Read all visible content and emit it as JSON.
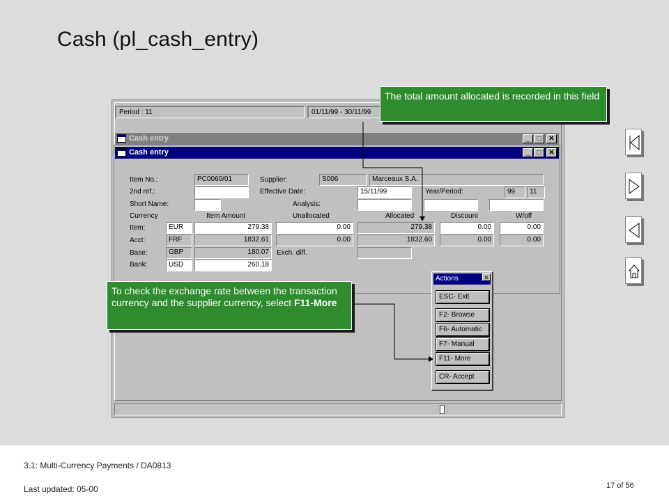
{
  "slide": {
    "title": "Cash (pl_cash_entry)",
    "footer_left": "3.1: Multi-Currency  Payments / DA0813",
    "footer_updated": "Last updated:  05-00",
    "page_label": "17 of 56"
  },
  "app": {
    "period_field": "Period : 11",
    "date_range_field": "01/11/99 - 30/11/99"
  },
  "windows": {
    "back_title": "Cash entry",
    "front_title": "Cash entry",
    "btn_min": "_",
    "btn_max": "□",
    "btn_close": "✕"
  },
  "form": {
    "labels": {
      "item_no": "Item No.:",
      "second_ref": "2nd ref.:",
      "short_name": "Short Name:",
      "currency": "Currency",
      "item": "Item:",
      "acct": "Acct:",
      "base": "Base:",
      "bank": "Bank:",
      "supplier": "Supplier:",
      "effective_date": "Effective Date:",
      "analysis": "Analysis:",
      "year_period": "Year/Period:",
      "exch_diff": "Exch. diff."
    },
    "columns": {
      "item_amount": "Item Amount",
      "unallocated": "Unallocated",
      "allocated": "Allocated",
      "discount": "Discount",
      "w_off": "W/off"
    },
    "values": {
      "item_no": "PC0060/01",
      "second_ref": "",
      "short_name": "",
      "supplier_code": "S006",
      "supplier_name": "Marceaux S.A.",
      "effective_date": "15/11/99",
      "year": "99",
      "period": "11",
      "analysis_1": "",
      "analysis_2": "",
      "analysis_3": ""
    },
    "rows": [
      {
        "currency": "EUR",
        "item_amount": "279.38",
        "unallocated": "0.00",
        "allocated": "279.38",
        "discount": "0.00",
        "w_off": "0.00"
      },
      {
        "currency": "FRF",
        "item_amount": "1832.61",
        "unallocated": "0.00",
        "allocated": "1832.60",
        "discount": "0.00",
        "w_off": "0.00"
      },
      {
        "currency": "GBP",
        "item_amount": "180.07"
      },
      {
        "currency": "USD",
        "item_amount": "260.18"
      }
    ],
    "exch_diff_value": ""
  },
  "actions_dialog": {
    "title": "Actions",
    "close": "✕",
    "buttons": [
      "ESC- Exit",
      "F2- Browse",
      "F6- Automatic",
      "F7- Manual",
      "F11- More",
      "CR- Accept"
    ]
  },
  "callouts": {
    "top": "The total amount allocated is recorded in this field",
    "left_prefix": "To check the exchange rate between the transaction currency and the supplier currency, select ",
    "left_bold": "F11-More"
  },
  "colors": {
    "callout_green": "#2e8b2e",
    "active_title": "#000080",
    "inactive_title": "#808080"
  },
  "icons": [
    "nav-first-icon",
    "nav-next-icon",
    "nav-prev-icon",
    "nav-home-icon"
  ]
}
